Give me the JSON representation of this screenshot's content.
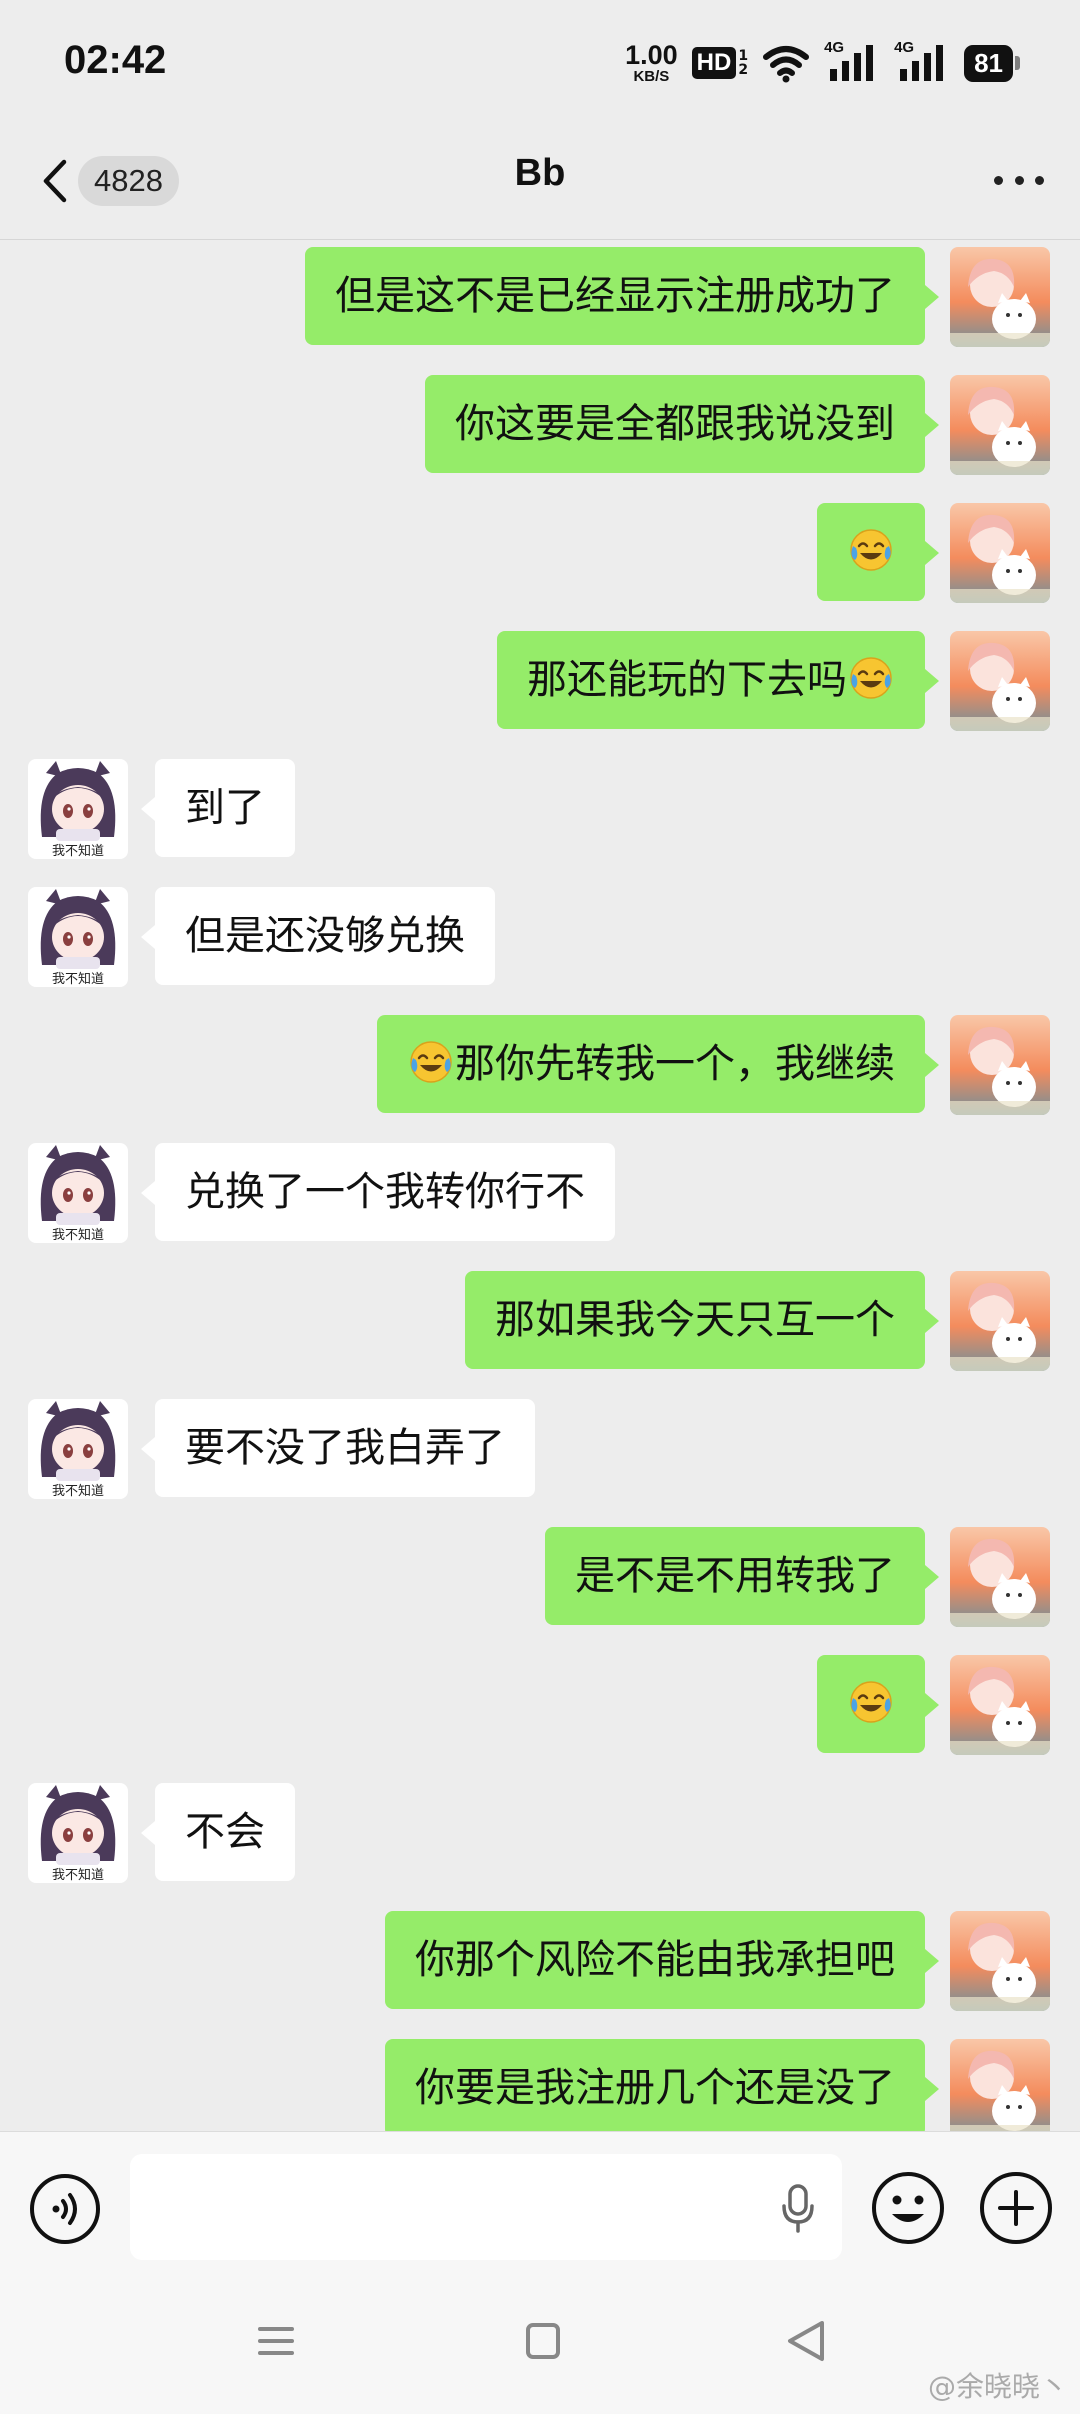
{
  "status_bar": {
    "time": "02:42",
    "net_speed_value": "1.00",
    "net_speed_unit": "KB/S",
    "hd_label": "HD",
    "hd_sub_1": "1",
    "hd_sub_2": "2",
    "signal_1_label": "4G",
    "signal_2_label": "4G",
    "battery": "81"
  },
  "header": {
    "unread_count": "4828",
    "title": "Bb"
  },
  "messages": [
    {
      "from": "me",
      "text": "但是这不是已经显示注册成功了"
    },
    {
      "from": "me",
      "text": "你这要是全都跟我说没到"
    },
    {
      "from": "me",
      "text": "",
      "emoji_after": "crying-laughing-emoji"
    },
    {
      "from": "me",
      "text": "那还能玩的下去吗",
      "emoji_after": "crying-laughing-emoji"
    },
    {
      "from": "them",
      "text": "到了"
    },
    {
      "from": "them",
      "text": "但是还没够兑换"
    },
    {
      "from": "me",
      "text": "那你先转我一个，我继续",
      "emoji_before": "crying-laughing-emoji"
    },
    {
      "from": "them",
      "text": "兑换了一个我转你行不"
    },
    {
      "from": "me",
      "text": "那如果我今天只互一个"
    },
    {
      "from": "them",
      "text": "要不没了我白弄了"
    },
    {
      "from": "me",
      "text": "是不是不用转我了"
    },
    {
      "from": "me",
      "text": "",
      "emoji_after": "crying-laughing-emoji"
    },
    {
      "from": "them",
      "text": "不会"
    },
    {
      "from": "me",
      "text": "你那个风险不能由我承担吧"
    },
    {
      "from": "me",
      "text": "你要是我注册几个还是没了"
    }
  ],
  "avatars": {
    "them_caption": "我不知道"
  },
  "watermark": "@余晓晓丶",
  "colors": {
    "background": "#ededed",
    "my_bubble": "#95ec69",
    "their_bubble": "#ffffff",
    "emoji_yellow": "#f7c531",
    "emoji_tear_blue": "#4aa3e6"
  }
}
